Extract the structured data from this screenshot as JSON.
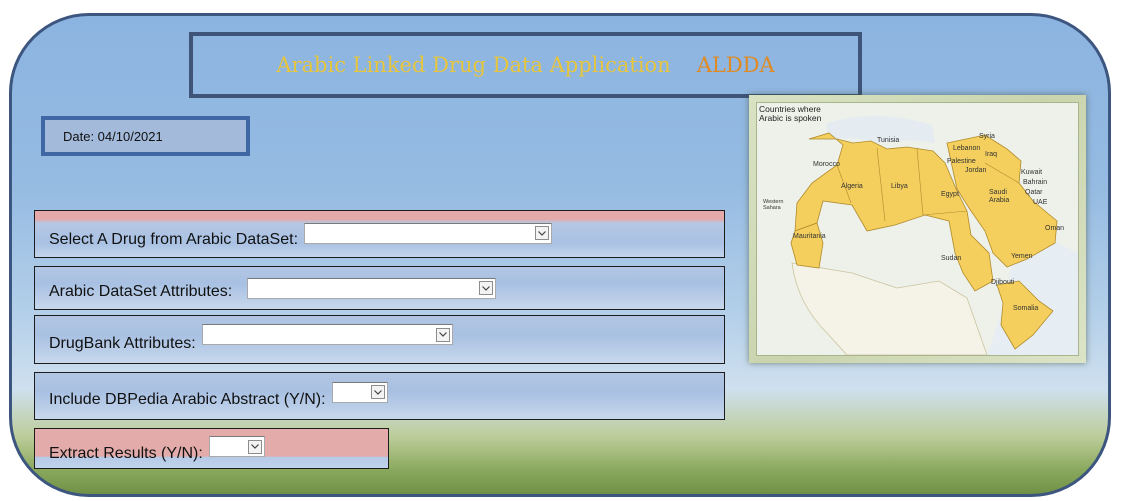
{
  "header": {
    "title_main": "Arabic Linked Drug Data Application",
    "title_abbr": "ALDDA"
  },
  "date_label": "Date: 04/10/2021",
  "form": {
    "select_drug_label": "Select A Drug from Arabic DataSet:",
    "arabic_attributes_label": "Arabic DataSet Attributes:",
    "drugbank_attributes_label": "DrugBank Attributes:",
    "dbpedia_abstract_label": "Include DBPedia Arabic Abstract (Y/N):",
    "extract_results_label": "Extract Results (Y/N):"
  },
  "map": {
    "caption_line1": "Countries where",
    "caption_line2": "Arabic is spoken",
    "countries": {
      "tunisia": "Tunisia",
      "syria": "Syria",
      "lebanon": "Lebanon",
      "iraq": "Iraq",
      "palestine": "Palestine",
      "jordan": "Jordan",
      "morocco": "Morocco",
      "kuwait": "Kuwait",
      "bahrain": "Bahrain",
      "qatar": "Qatar",
      "uae": "UAE",
      "algeria": "Algeria",
      "libya": "Libya",
      "egypt": "Egypt",
      "saudi": "Saudi Arabia",
      "western_sahara": "Western Sahara",
      "mauritania": "Mauritania",
      "oman": "Oman",
      "sudan": "Sudan",
      "yemen": "Yemen",
      "djibouti": "Djibouti",
      "somalia": "Somalia"
    }
  },
  "colors": {
    "title_main": "#e7c53c",
    "title_abbr": "#e08a23",
    "panel_border": "#3d5680",
    "highlight_pink": "#e3acab",
    "map_arabic": "#f4cf5d"
  },
  "icons": {
    "dropdown": "chevron-down-icon"
  }
}
